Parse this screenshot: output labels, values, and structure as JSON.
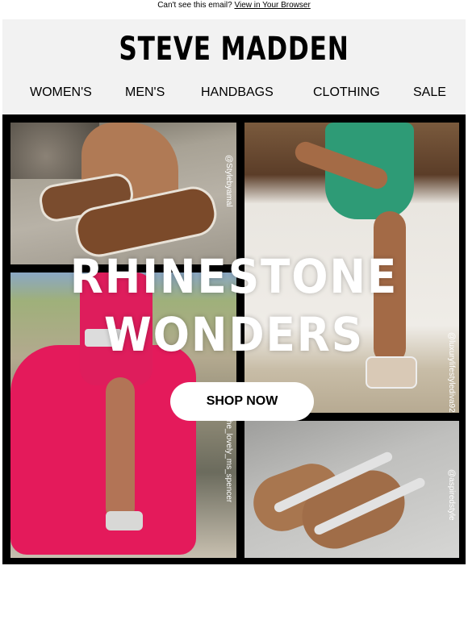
{
  "preheader": {
    "text": "Can't see this email?",
    "link": "View in Your Browser"
  },
  "header": {
    "logo": "STEVE MADDEN",
    "nav": [
      "WOMEN'S",
      "MEN'S",
      "HANDBAGS",
      "CLOTHING",
      "SALE"
    ]
  },
  "hero": {
    "headline_line1": "RHINESTONE",
    "headline_line2": "WONDERS",
    "cta_label": "SHOP NOW",
    "credits": [
      "@Stylebyamal",
      "@luxurylifestylediva92",
      "@the_lovely_ms_spencer",
      "@aspiredstyle"
    ]
  },
  "colors": {
    "header_bg": "#f2f2f2",
    "hero_bg": "#000000",
    "headline": "#ffffff",
    "cta_bg": "#ffffff"
  }
}
